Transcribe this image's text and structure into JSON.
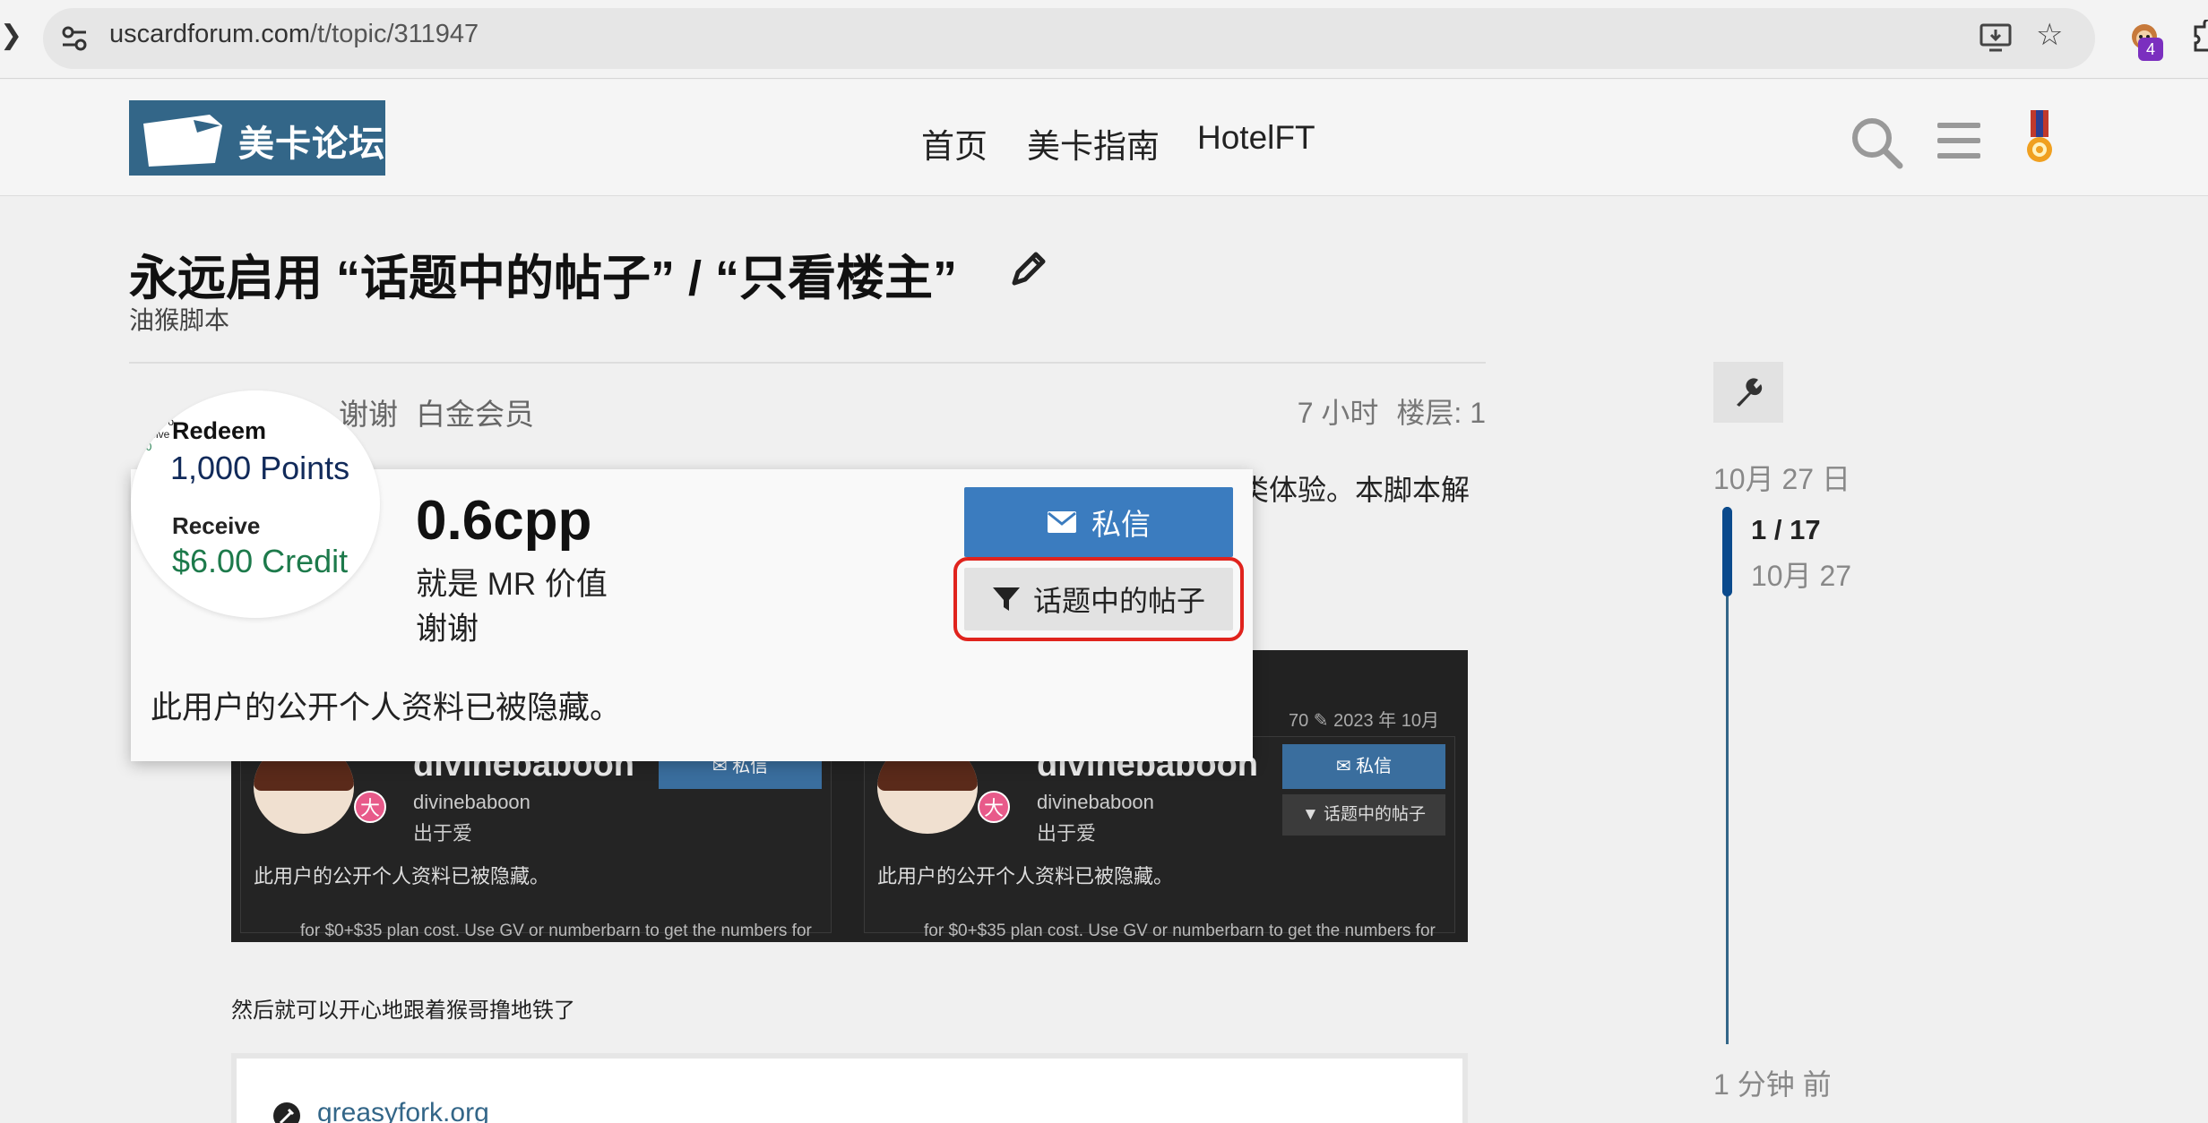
{
  "browser": {
    "url_host": "uscardforum.com",
    "url_path": "/t/topic/311947",
    "extension_badge": "4",
    "left_glyph": "❯"
  },
  "header": {
    "logo_text": "美卡论坛",
    "nav": [
      "首页",
      "美卡指南",
      "HotelFT"
    ]
  },
  "topic": {
    "title": "永远启用 “话题中的帖子” / “只看楼主”",
    "category": "油猴脚本"
  },
  "post": {
    "meta_names": [
      "谢谢",
      "白金会员"
    ],
    "time": "7 小时",
    "floor": "楼层: 1",
    "snippet": "类体验。本脚本解"
  },
  "usercard": {
    "avatar": {
      "tiny_lines": [
        "Redeem",
        "1,000 Po",
        "Receive",
        "$6.0"
      ],
      "redeem_label": "Redeem",
      "points": "1,000 Points",
      "receive_label": "Receive",
      "credit": "$6.00 Credit"
    },
    "name": "0.6cpp",
    "title": "就是 MR 价值",
    "bio": "谢谢",
    "message_button": "私信",
    "filter_button": "话题中的帖子",
    "hidden_notice": "此用户的公开个人资料已被隐藏。"
  },
  "embed": {
    "meta": "70 ✎  2023 年 10月",
    "cards": [
      {
        "name": "divinebaboon",
        "username": "divinebaboon",
        "bio": "出于爱",
        "badge": "大",
        "message_button": "私信",
        "hidden": "此用户的公开个人资料已被隐藏。",
        "footer": "for $0+$35 plan cost. Use GV or numberbarn to get the numbers for"
      },
      {
        "name": "divinebaboon",
        "username": "divinebaboon",
        "bio": "出于爱",
        "badge": "大",
        "message_button": "私信",
        "filter_button": "话题中的帖子",
        "hidden": "此用户的公开个人资料已被隐藏。",
        "footer": "for $0+$35 plan cost. Use GV or numberbarn to get the numbers for"
      }
    ]
  },
  "after_text": "然后就可以开心地跟着猴哥撸地铁了",
  "onebox": {
    "link": "greasyfork.org"
  },
  "timeline": {
    "date": "10月 27 日",
    "count": "1 / 17",
    "sub_date": "10月 27",
    "ago": "1 分钟 前"
  },
  "colors": {
    "brand_blue": "#336688",
    "button_blue": "#3b7cbf",
    "highlight_red": "#e0231d",
    "credit_green": "#1d7a4b"
  }
}
